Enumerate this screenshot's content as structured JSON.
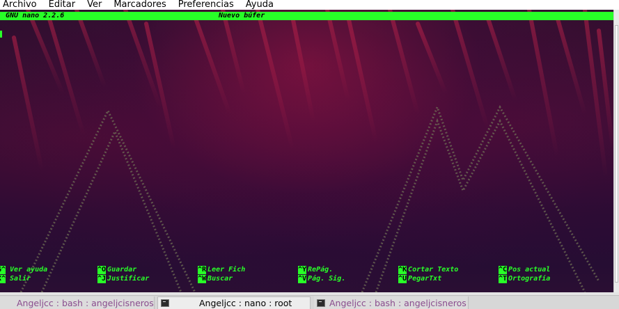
{
  "menu": [
    "Archivo",
    "Editar",
    "Ver",
    "Marcadores",
    "Preferencias",
    "Ayuda"
  ],
  "nano": {
    "version": "GNU nano 2.2.6",
    "buffer": "Nuevo búfer"
  },
  "shortcuts": {
    "row1": [
      {
        "key": "^G",
        "label": "Ver ayuda"
      },
      {
        "key": "^O",
        "label": "Guardar"
      },
      {
        "key": "^R",
        "label": "Leer Fich"
      },
      {
        "key": "^Y",
        "label": "RePág."
      },
      {
        "key": "^K",
        "label": "Cortar Texto"
      },
      {
        "key": "^C",
        "label": "Pos actual"
      }
    ],
    "row2": [
      {
        "key": "^X",
        "label": "Salir"
      },
      {
        "key": "^J",
        "label": "Justificar"
      },
      {
        "key": "^W",
        "label": "Buscar"
      },
      {
        "key": "^V",
        "label": "Pág. Sig."
      },
      {
        "key": "^U",
        "label": "PegarTxt"
      },
      {
        "key": "^T",
        "label": "Ortografía"
      }
    ]
  },
  "taskbar": {
    "tasks": [
      {
        "title": "Angeljcc : bash : angeljcisneros",
        "active": false
      },
      {
        "title": "Angeljcc : nano : root",
        "active": true
      },
      {
        "title": "Angeljcc : bash : angeljcisneros",
        "active": false
      }
    ]
  },
  "colors": {
    "nano_green": "#28ff28",
    "inactive_task_text": "#8a4d8e"
  }
}
